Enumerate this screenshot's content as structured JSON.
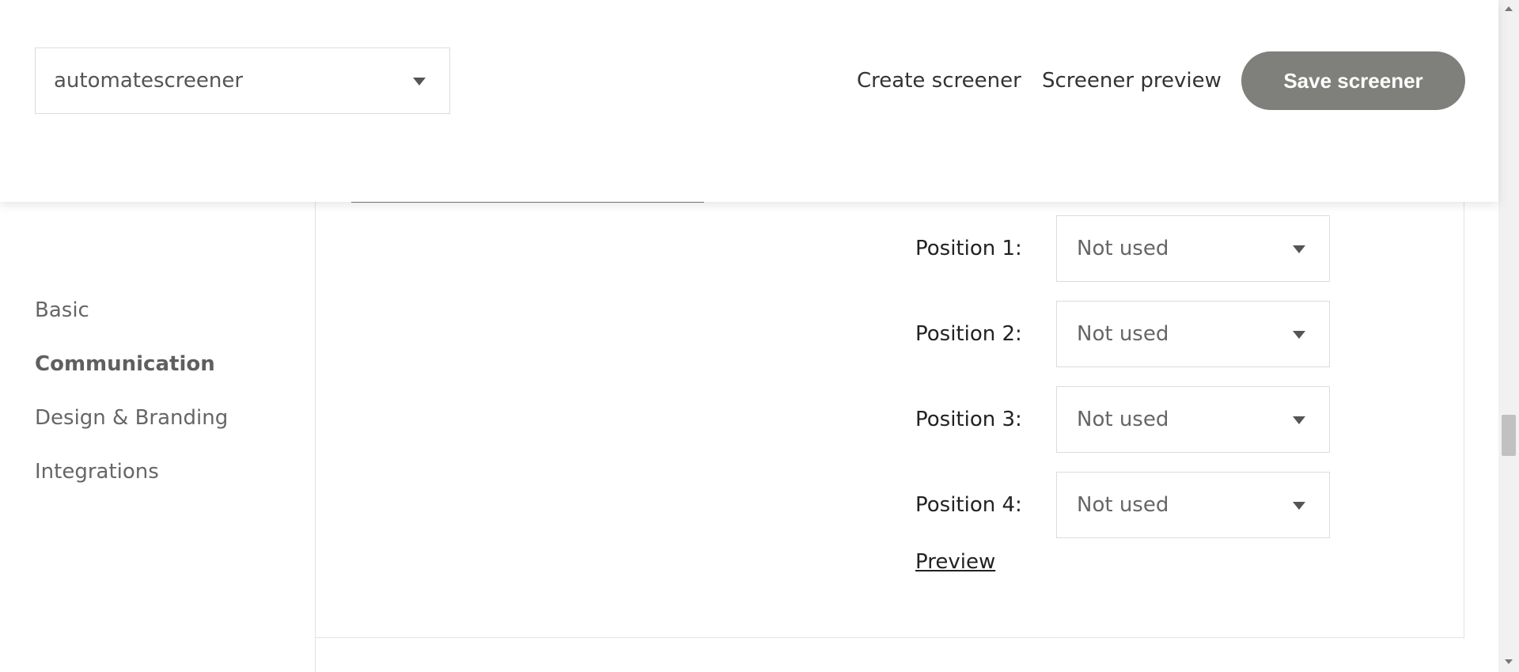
{
  "header": {
    "screener_select": {
      "value": "automatescreener",
      "icon": "chevron-down-icon"
    },
    "nav": {
      "create_label": "Create screener",
      "preview_label": "Screener preview"
    },
    "save_label": "Save screener",
    "save_color": "#7f807b"
  },
  "sidebar": {
    "items": [
      {
        "label": "Basic"
      },
      {
        "label": "Communication",
        "active": true
      },
      {
        "label": "Design & Branding"
      },
      {
        "label": "Integrations"
      }
    ]
  },
  "main": {
    "positions": [
      {
        "label": "Position 1:",
        "value": "Not used"
      },
      {
        "label": "Position 2:",
        "value": "Not used"
      },
      {
        "label": "Position 3:",
        "value": "Not used"
      },
      {
        "label": "Position 4:",
        "value": "Not used"
      }
    ],
    "preview_link": "Preview"
  }
}
